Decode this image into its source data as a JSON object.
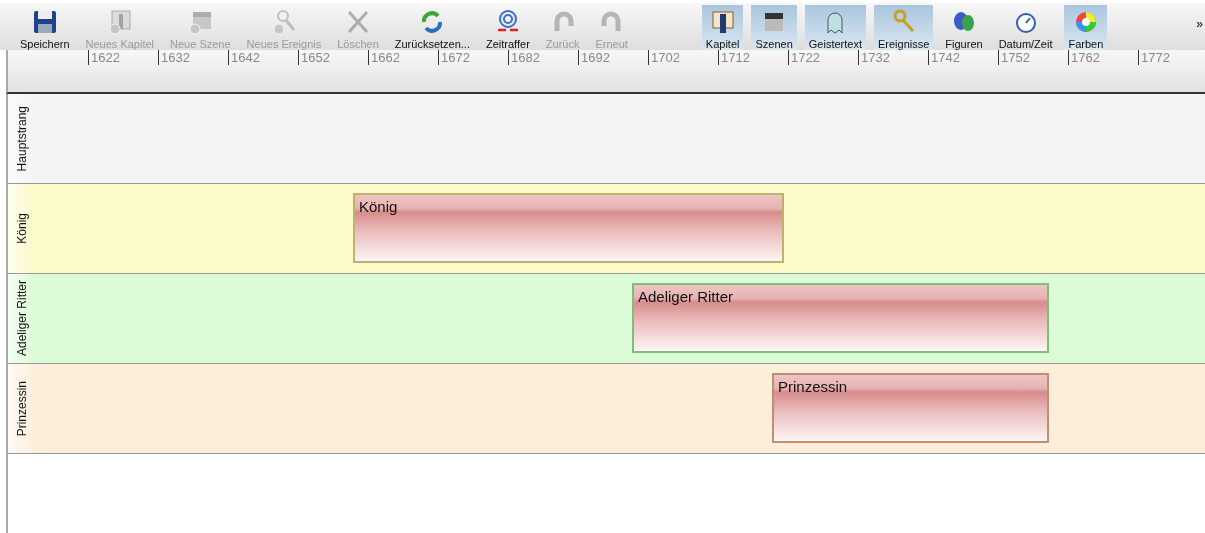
{
  "toolbar": {
    "actions": [
      {
        "label": "Speichern",
        "disabled": false
      },
      {
        "label": "Neues Kapitel",
        "disabled": true
      },
      {
        "label": "Neue Szene",
        "disabled": true
      },
      {
        "label": "Neues Ereignis",
        "disabled": true
      },
      {
        "label": "Löschen",
        "disabled": true
      },
      {
        "label": "Zurücksetzen...",
        "disabled": false
      },
      {
        "label": "Zeitraffer",
        "disabled": false
      },
      {
        "label": "Zurück",
        "disabled": true
      },
      {
        "label": "Erneut",
        "disabled": true
      }
    ],
    "views": [
      {
        "label": "Kapitel",
        "selected": true
      },
      {
        "label": "Szenen",
        "selected": true
      },
      {
        "label": "Geistertext",
        "selected": true
      },
      {
        "label": "Ereignisse",
        "selected": true
      },
      {
        "label": "Figuren",
        "selected": false
      },
      {
        "label": "Datum/Zeit",
        "selected": false
      },
      {
        "label": "Farben",
        "selected": true
      }
    ],
    "overflow": "»"
  },
  "timeline": {
    "ruler": [
      "1622",
      "1632",
      "1642",
      "1652",
      "1662",
      "1672",
      "1682",
      "1692",
      "1702",
      "1712",
      "1722",
      "1732",
      "1742",
      "1752",
      "1762",
      "1772"
    ],
    "lanes": [
      {
        "label": "Hauptstrang",
        "color": "#f3f3f3"
      },
      {
        "label": "König",
        "color": "#fcfac6",
        "bar": {
          "label": "König",
          "color": "#c2b06e"
        }
      },
      {
        "label": "Adeliger Ritter",
        "color": "#dbfcd6",
        "bar": {
          "label": "Adeliger Ritter",
          "color": "#7fbf7a"
        }
      },
      {
        "label": "Prinzessin",
        "color": "#fdeedc",
        "bar": {
          "label": "Prinzessin",
          "color": "#bf8f6e"
        }
      }
    ]
  }
}
